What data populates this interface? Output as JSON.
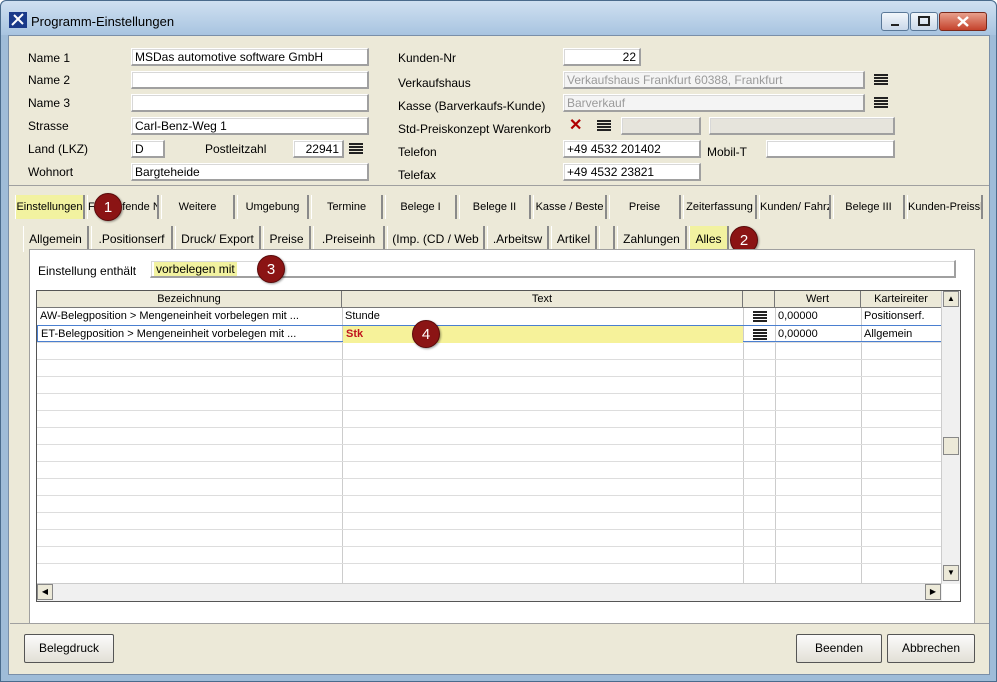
{
  "window": {
    "title": "Programm-Einstellungen"
  },
  "customer": {
    "name1_label": "Name 1",
    "name1": "MSDas automotive software GmbH",
    "name2_label": "Name 2",
    "name2": "",
    "name3_label": "Name 3",
    "name3": "",
    "strasse_label": "Strasse",
    "strasse": "Carl-Benz-Weg 1",
    "land_label": "Land (LKZ)",
    "land": "D",
    "plz_label": "Postleitzahl",
    "plz": "22941",
    "wohnort_label": "Wohnort",
    "wohnort": "Bargteheide",
    "kundennr_label": "Kunden-Nr",
    "kundennr": "22",
    "verkaufshaus_label": "Verkaufshaus",
    "verkaufshaus": "Verkaufshaus Frankfurt 60388, Frankfurt",
    "kasse_label": "Kasse (Barverkaufs-Kunde)",
    "kasse": "Barverkauf",
    "preiskonzept_label": "Std-Preiskonzept Warenkorb",
    "telefon_label": "Telefon",
    "telefon": "+49 4532 201402",
    "mobil_label": "Mobil-T",
    "mobil": "",
    "telefax_label": "Telefax",
    "telefax": "+49 4532 23821"
  },
  "tabs1": [
    "Einstellungen",
    "Fortlaufende N",
    "Weitere",
    "Umgebung",
    "Termine",
    "Belege I",
    "Belege II",
    "Kasse / Beste",
    "Preise",
    "Zeiterfassung",
    "Kunden/ Fahrz",
    "Belege III",
    "Kunden-Preissl"
  ],
  "tabs2": [
    "Allgemein",
    ".Positionserf",
    "Druck/ Export",
    "Preise",
    ".Preiseinh",
    "(Imp. (CD / Web",
    ".Arbeitsw",
    "Artikel",
    "",
    "Zahlungen",
    "Alles"
  ],
  "filter": {
    "label": "Einstellung enthält",
    "value": "vorbelegen mit"
  },
  "grid": {
    "columns": [
      "Bezeichnung",
      "Text",
      "",
      "Wert",
      "Karteireiter"
    ],
    "rows": [
      {
        "bezeichnung": "AW-Belegposition > Mengeneinheit vorbelegen mit ...",
        "text": "Stunde",
        "wert": "0,00000",
        "karteireiter": "Positionserf."
      },
      {
        "bezeichnung": "ET-Belegposition > Mengeneinheit vorbelegen mit ...",
        "text": "Stk",
        "wert": "0,00000",
        "karteireiter": "Allgemein"
      }
    ]
  },
  "badges": [
    "1",
    "2",
    "3",
    "4"
  ],
  "buttons": {
    "belegdruck": "Belegdruck",
    "beenden": "Beenden",
    "abbrechen": "Abbrechen"
  },
  "colors": {
    "selected_tab": "#f2f2a0",
    "badge": "#8b1414",
    "title_bg": "#a8c4e0"
  }
}
